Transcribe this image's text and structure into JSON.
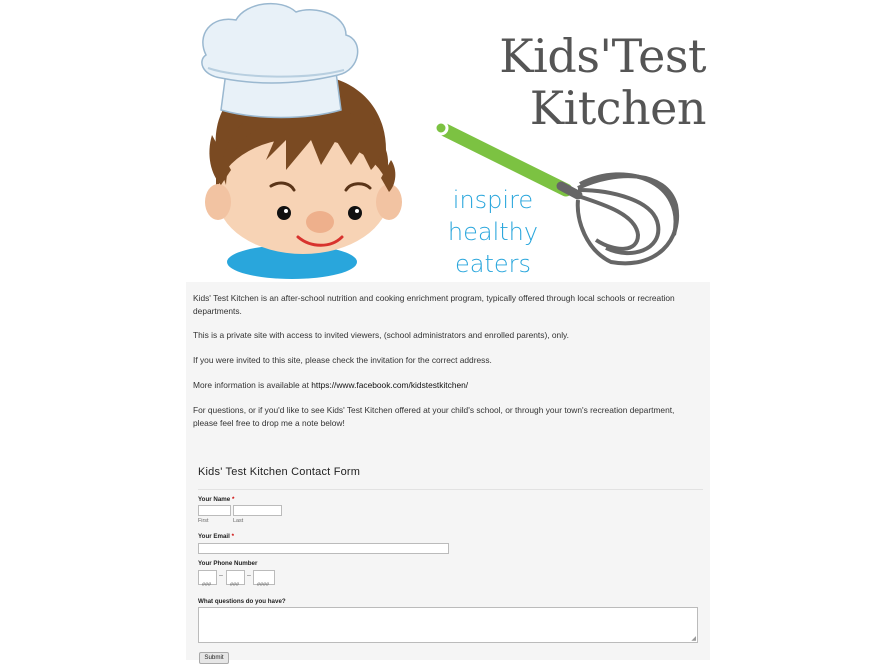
{
  "header": {
    "title_line1": "Kids'Test",
    "title_line2": "Kitchen",
    "tagline_line1": "inspire",
    "tagline_line2": "healthy eaters"
  },
  "content": {
    "paragraph1": "Kids' Test Kitchen is an after-school nutrition and cooking enrichment program, typically offered through local schools or recreation departments.",
    "paragraph2": "This is a private site with access to invited viewers, (school administrators and enrolled parents), only.",
    "paragraph3": "If you were invited to this site, please check the invitation for the correct address.",
    "paragraph4_prefix": "More information is available at ",
    "paragraph4_link": "https://www.facebook.com/kidstestkitchen/",
    "paragraph5": "For questions, or if you'd like to see Kids' Test Kitchen offered at your child's school, or through your town's recreation department, please feel free to drop me a note below!"
  },
  "form": {
    "title": "Kids' Test Kitchen Contact Form",
    "name_label": "Your Name",
    "required_mark": "*",
    "first_sub": "First",
    "last_sub": "Last",
    "email_label": "Your Email",
    "phone_label": "Your Phone Number",
    "phone_area_sub": "###",
    "phone_prefix_sub": "###",
    "phone_line_sub": "####",
    "phone_dash": "–",
    "question_label": "What questions do you have?",
    "submit_label": "Submit"
  },
  "colors": {
    "accent_blue": "#29a6dc",
    "whisk_green": "#7cc242",
    "title_gray": "#555555"
  }
}
